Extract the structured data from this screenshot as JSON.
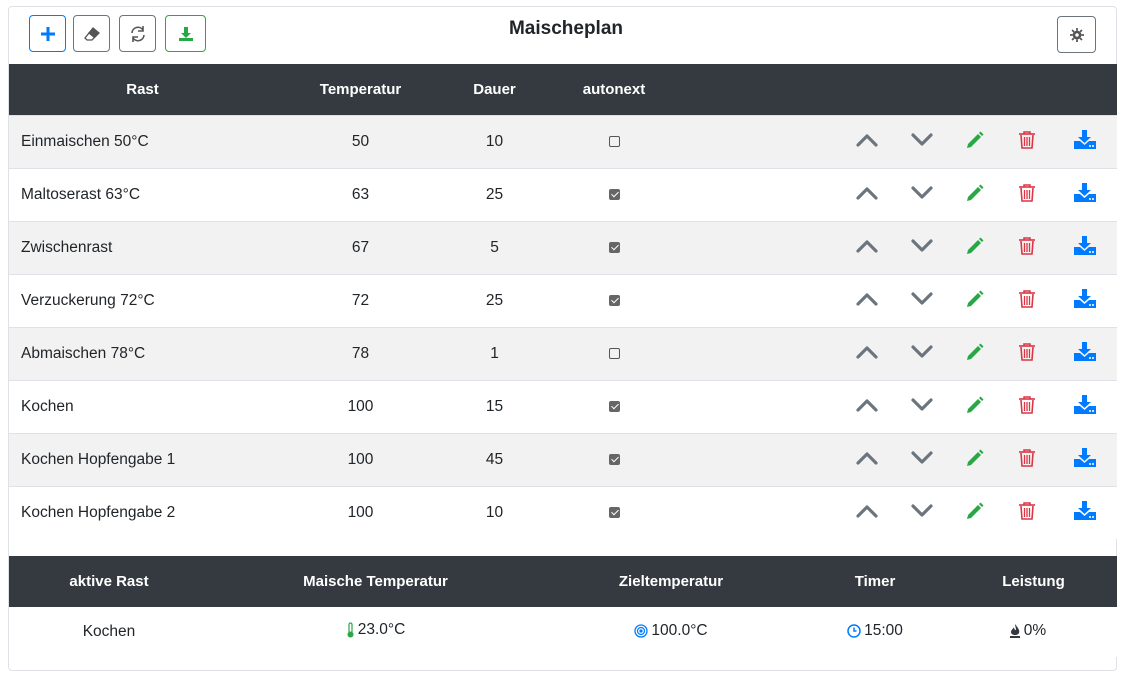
{
  "toolbar": {
    "title": "Maischeplan",
    "buttons": [
      {
        "name": "add-button",
        "icon": "plus-icon",
        "color": "#007bff"
      },
      {
        "name": "clear-button",
        "icon": "eraser-icon",
        "color": "#6c757d"
      },
      {
        "name": "refresh-button",
        "icon": "refresh-icon",
        "color": "#6c757d"
      },
      {
        "name": "download-button",
        "icon": "download-icon",
        "color": "#28a745"
      }
    ],
    "settings_icon": "gear-icon"
  },
  "plan": {
    "headers": [
      "Rast",
      "Temperatur",
      "Dauer",
      "autonext"
    ],
    "rows": [
      {
        "name": "Einmaischen 50°C",
        "temp": "50",
        "duration": "10",
        "autonext": false
      },
      {
        "name": "Maltoserast 63°C",
        "temp": "63",
        "duration": "25",
        "autonext": true
      },
      {
        "name": "Zwischenrast",
        "temp": "67",
        "duration": "5",
        "autonext": true
      },
      {
        "name": "Verzuckerung 72°C",
        "temp": "72",
        "duration": "25",
        "autonext": true
      },
      {
        "name": "Abmaischen 78°C",
        "temp": "78",
        "duration": "1",
        "autonext": false
      },
      {
        "name": "Kochen",
        "temp": "100",
        "duration": "15",
        "autonext": true
      },
      {
        "name": "Kochen Hopfengabe 1",
        "temp": "100",
        "duration": "45",
        "autonext": true
      },
      {
        "name": "Kochen Hopfengabe 2",
        "temp": "100",
        "duration": "10",
        "autonext": true
      }
    ],
    "row_actions": [
      "chevron-up-icon",
      "chevron-down-icon",
      "pencil-icon",
      "trash-icon",
      "download-icon"
    ]
  },
  "status": {
    "headers": [
      "aktive Rast",
      "Maische Temperatur",
      "Zieltemperatur",
      "Timer",
      "Leistung"
    ],
    "active_rest": "Kochen",
    "mash_temp": "23.0°C",
    "target_temp": "100.0°C",
    "timer": "15:00",
    "power": "0%",
    "icons": {
      "mash_temp": "thermometer-icon",
      "target_temp": "target-icon",
      "timer": "clock-icon",
      "power": "fire-icon"
    }
  },
  "colors": {
    "header_bg": "#343a40",
    "primary": "#007bff",
    "success": "#28a745",
    "danger": "#dc3545",
    "secondary": "#6c757d",
    "highlight": "#ffff00"
  }
}
